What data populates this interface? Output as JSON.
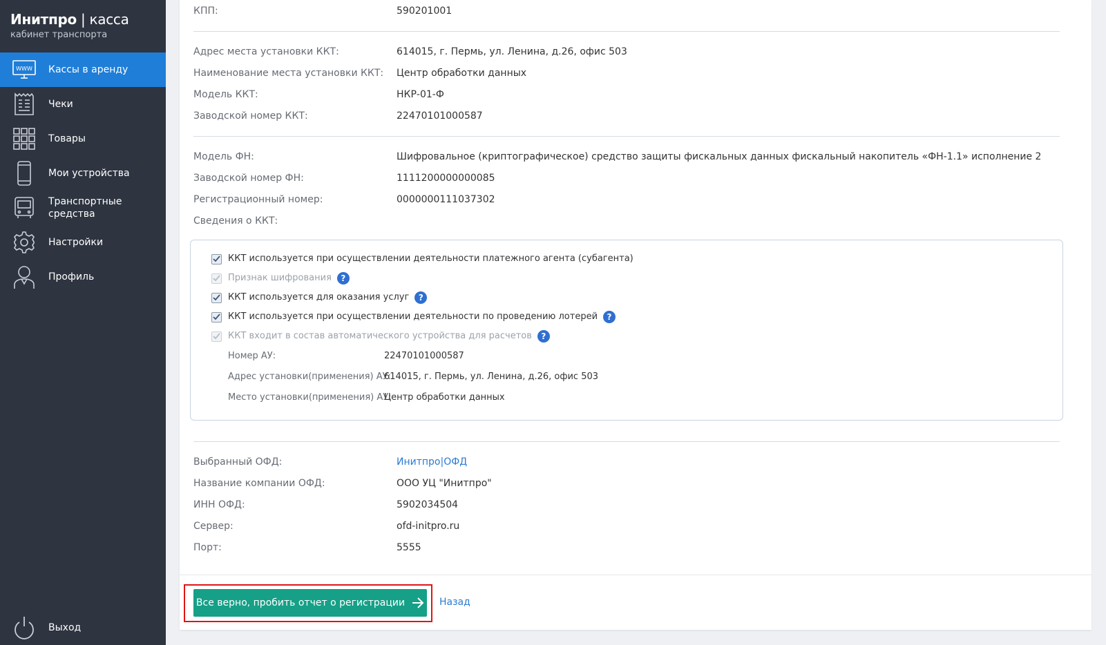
{
  "sidebar": {
    "brand_main": "Инитпро",
    "brand_sep": " | ",
    "brand_thin": "касса",
    "brand_sub": "кабинет транспорта",
    "items": [
      {
        "label": "Кассы в аренду",
        "icon": "www-monitor-icon"
      },
      {
        "label": "Чеки",
        "icon": "receipt-icon"
      },
      {
        "label": "Товары",
        "icon": "grid-icon"
      },
      {
        "label": "Мои устройства",
        "icon": "phone-icon"
      },
      {
        "label": "Транспортные средства",
        "icon": "bus-icon"
      },
      {
        "label": "Настройки",
        "icon": "gear-icon"
      },
      {
        "label": "Профиль",
        "icon": "user-icon"
      }
    ],
    "logout": "Выход"
  },
  "details": {
    "kpp_label": "КПП:",
    "kpp_value": "590201001",
    "address_label": "Адрес места установки ККТ:",
    "address_value": "614015, г. Пермь, ул. Ленина, д.26, офис 503",
    "place_label": "Наименование места установки ККТ:",
    "place_value": "Центр обработки данных",
    "model_label": "Модель ККТ:",
    "model_value": "НКР-01-Ф",
    "serial_label": "Заводской номер ККТ:",
    "serial_value": "22470101000587",
    "fn_model_label": "Модель ФН:",
    "fn_model_value": "Шифровальное (криптографическое) средство защиты фискальных данных фискальный накопитель «ФН-1.1» исполнение 2",
    "fn_serial_label": "Заводской номер ФН:",
    "fn_serial_value": "1111200000000085",
    "reg_label": "Регистрационный номер:",
    "reg_value": "0000000111037302",
    "kkt_info_label": "Сведения о ККТ:"
  },
  "checkboxes": [
    {
      "label": "ККТ используется при осуществлении деятельности платежного агента (субагента)",
      "checked": true,
      "disabled": false,
      "help": false
    },
    {
      "label": "Признак шифрования",
      "checked": true,
      "disabled": true,
      "help": true
    },
    {
      "label": "ККТ используется для оказания услуг",
      "checked": true,
      "disabled": false,
      "help": true
    },
    {
      "label": "ККТ используется при осуществлении деятельности по проведению лотерей",
      "checked": true,
      "disabled": false,
      "help": true
    },
    {
      "label": "ККТ входит в состав автоматического устройства для расчетов",
      "checked": true,
      "disabled": true,
      "help": true
    }
  ],
  "au": {
    "number_label": "Номер АУ:",
    "number_value": "22470101000587",
    "address_label": "Адрес установки(применения) АУ:",
    "address_value": "614015, г. Пермь, ул. Ленина, д.26, офис 503",
    "place_label": "Место установки(применения) АУ:",
    "place_value": "Центр обработки данных"
  },
  "ofd": {
    "selected_label": "Выбранный ОФД:",
    "selected_value": "Инитпро|ОФД",
    "company_label": "Название компании ОФД:",
    "company_value": "ООО УЦ \"Инитпро\"",
    "inn_label": "ИНН ОФД:",
    "inn_value": "5902034504",
    "server_label": "Сервер:",
    "server_value": "ofd-initpro.ru",
    "port_label": "Порт:",
    "port_value": "5555"
  },
  "footer": {
    "confirm_label": "Все верно, пробить отчет о регистрации",
    "back_label": "Назад"
  },
  "colors": {
    "sidebar_bg": "#2e3440",
    "active_item": "#1f7ed8",
    "primary_button": "#15a087",
    "link": "#2a7ad2",
    "help_icon": "#2f6fd1",
    "highlight_border": "#e01515"
  }
}
